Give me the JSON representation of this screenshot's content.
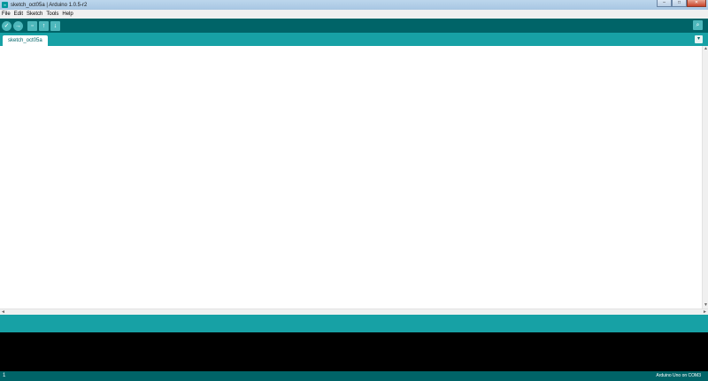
{
  "window": {
    "title": "sketch_oct05a | Arduino 1.0.5-r2",
    "icon_label": "∞",
    "controls": {
      "minimize": "–",
      "maximize": "□",
      "close": "✕"
    }
  },
  "menu": {
    "items": [
      {
        "label": "File"
      },
      {
        "label": "Edit"
      },
      {
        "label": "Sketch"
      },
      {
        "label": "Tools"
      },
      {
        "label": "Help"
      }
    ]
  },
  "toolbar": {
    "verify_icon": "✓",
    "upload_icon": "→",
    "new_icon": "▫",
    "open_icon": "↑",
    "save_icon": "↓",
    "serial_monitor_icon": "⌕"
  },
  "tabs": {
    "items": [
      {
        "label": "sketch_oct05a"
      }
    ],
    "menu_icon": "▾"
  },
  "editor": {
    "content": ""
  },
  "scrollbars": {
    "up": "▲",
    "down": "▼",
    "left": "◄",
    "right": "►"
  },
  "console": {
    "text": ""
  },
  "status": {
    "line_number": "1",
    "board_port": "Arduino Uno on COM3"
  },
  "colors": {
    "toolbar": "#006468",
    "tabstrip": "#17a1a5",
    "console": "#000000"
  }
}
